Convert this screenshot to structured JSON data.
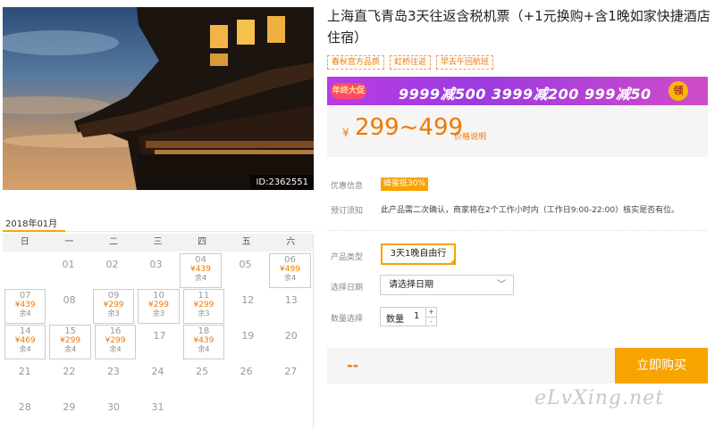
{
  "photo": {
    "id_label": "ID:2362551"
  },
  "calendar": {
    "month": "2018年01月",
    "weekdays": [
      "日",
      "一",
      "二",
      "三",
      "四",
      "五",
      "六"
    ],
    "weeks": [
      [
        {
          "day": ""
        },
        {
          "day": "01"
        },
        {
          "day": "02"
        },
        {
          "day": "03"
        },
        {
          "day": "04",
          "price": "¥439",
          "remain": "余4"
        },
        {
          "day": "05"
        },
        {
          "day": "06",
          "price": "¥499",
          "remain": "余4"
        }
      ],
      [
        {
          "day": "07",
          "price": "¥439",
          "remain": "余4"
        },
        {
          "day": "08"
        },
        {
          "day": "09",
          "price": "¥299",
          "remain": "余3"
        },
        {
          "day": "10",
          "price": "¥299",
          "remain": "余3"
        },
        {
          "day": "11",
          "price": "¥299",
          "remain": "余3"
        },
        {
          "day": "12"
        },
        {
          "day": "13"
        }
      ],
      [
        {
          "day": "14",
          "price": "¥469",
          "remain": "余4"
        },
        {
          "day": "15",
          "price": "¥299",
          "remain": "余4"
        },
        {
          "day": "16",
          "price": "¥299",
          "remain": "余4"
        },
        {
          "day": "17"
        },
        {
          "day": "18",
          "price": "¥439",
          "remain": "余4"
        },
        {
          "day": "19"
        },
        {
          "day": "20"
        }
      ],
      [
        {
          "day": "21"
        },
        {
          "day": "22"
        },
        {
          "day": "23"
        },
        {
          "day": "24"
        },
        {
          "day": "25"
        },
        {
          "day": "26"
        },
        {
          "day": "27"
        }
      ],
      [
        {
          "day": "28"
        },
        {
          "day": "29"
        },
        {
          "day": "30"
        },
        {
          "day": "31"
        },
        {
          "day": ""
        },
        {
          "day": ""
        },
        {
          "day": ""
        }
      ]
    ]
  },
  "product": {
    "title": "上海直飞青岛3天往返含税机票（+1元换购+含1晚如家快捷酒店住宿）",
    "tags": [
      "春秋官方品质",
      "虹桥往返",
      "早去午回航班"
    ],
    "promo": {
      "badge": "年终大促",
      "text": "9999减500  3999减200  999减50",
      "coin": "领"
    },
    "price": {
      "currency": "¥",
      "range": "299~499",
      "note": "价格说明"
    },
    "discount": {
      "label": "优惠信息",
      "tag": "蜂蜜抵30%"
    },
    "booking_notice": {
      "label": "预订须知",
      "text": "此产品需二次确认，商家将在2个工作小时内（工作日9:00-22:00）核实是否有位。"
    },
    "options": {
      "type_label": "产品类型",
      "type_value": "3天1晚自由行",
      "date_label": "选择日期",
      "date_value": "请选择日期",
      "qty_label": "数量选择",
      "qty_inner_label": "数量",
      "qty_value": "1",
      "qty_plus": "+",
      "qty_minus": "-"
    },
    "total": "--",
    "buy_label": "立即购买"
  },
  "watermark": "eLvXing.net",
  "colors": {
    "accent": "#f7a300",
    "price": "#f07800",
    "promo": "#a63de1"
  }
}
